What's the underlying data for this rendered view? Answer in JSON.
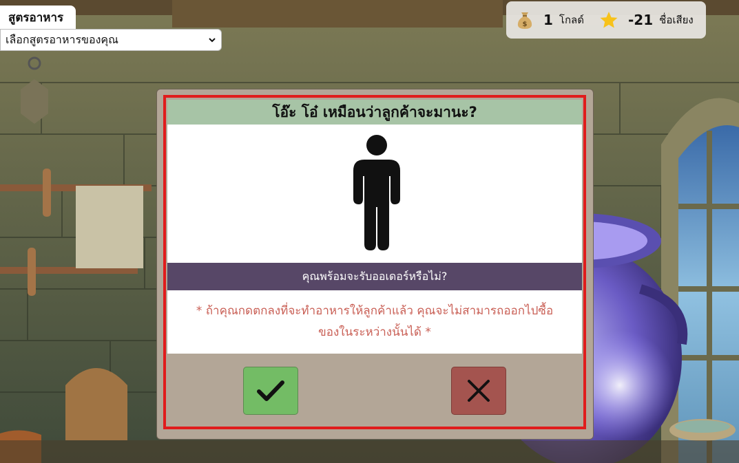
{
  "recipe": {
    "label": "สูตรอาหาร",
    "selected": "เลือกสูตรอาหารของคุณ"
  },
  "status": {
    "gold_value": "1",
    "gold_unit": "โกลด์",
    "reputation_value": "-21",
    "reputation_unit": "ชื่อเสียง"
  },
  "dialog": {
    "title": "โอ๊ะ โอ๋ เหมือนว่าลูกค้าจะมานะ?",
    "question": "คุณพร้อมจะรับออเดอร์หรือไม่?",
    "warning_line1": "* ถ้าคุณกดตกลงที่จะทำอาหารให้ลูกค้าแล้ว คุณจะไม่สามารถออกไปซื้อ",
    "warning_line2": "ของในระหว่างนั้นได้ *"
  },
  "icons": {
    "gold": "money-bag-icon",
    "reputation": "star-icon",
    "customer": "person-icon",
    "accept": "checkmark-icon",
    "decline": "x-icon"
  },
  "colors": {
    "title_bar": "#a7c4a6",
    "question_bar": "#574767",
    "warning_text": "#c95f55",
    "frame_border": "#e01c1c",
    "dialog_bg": "#b3a697",
    "accept_button": "#73bc65",
    "decline_button": "#a4544f"
  }
}
